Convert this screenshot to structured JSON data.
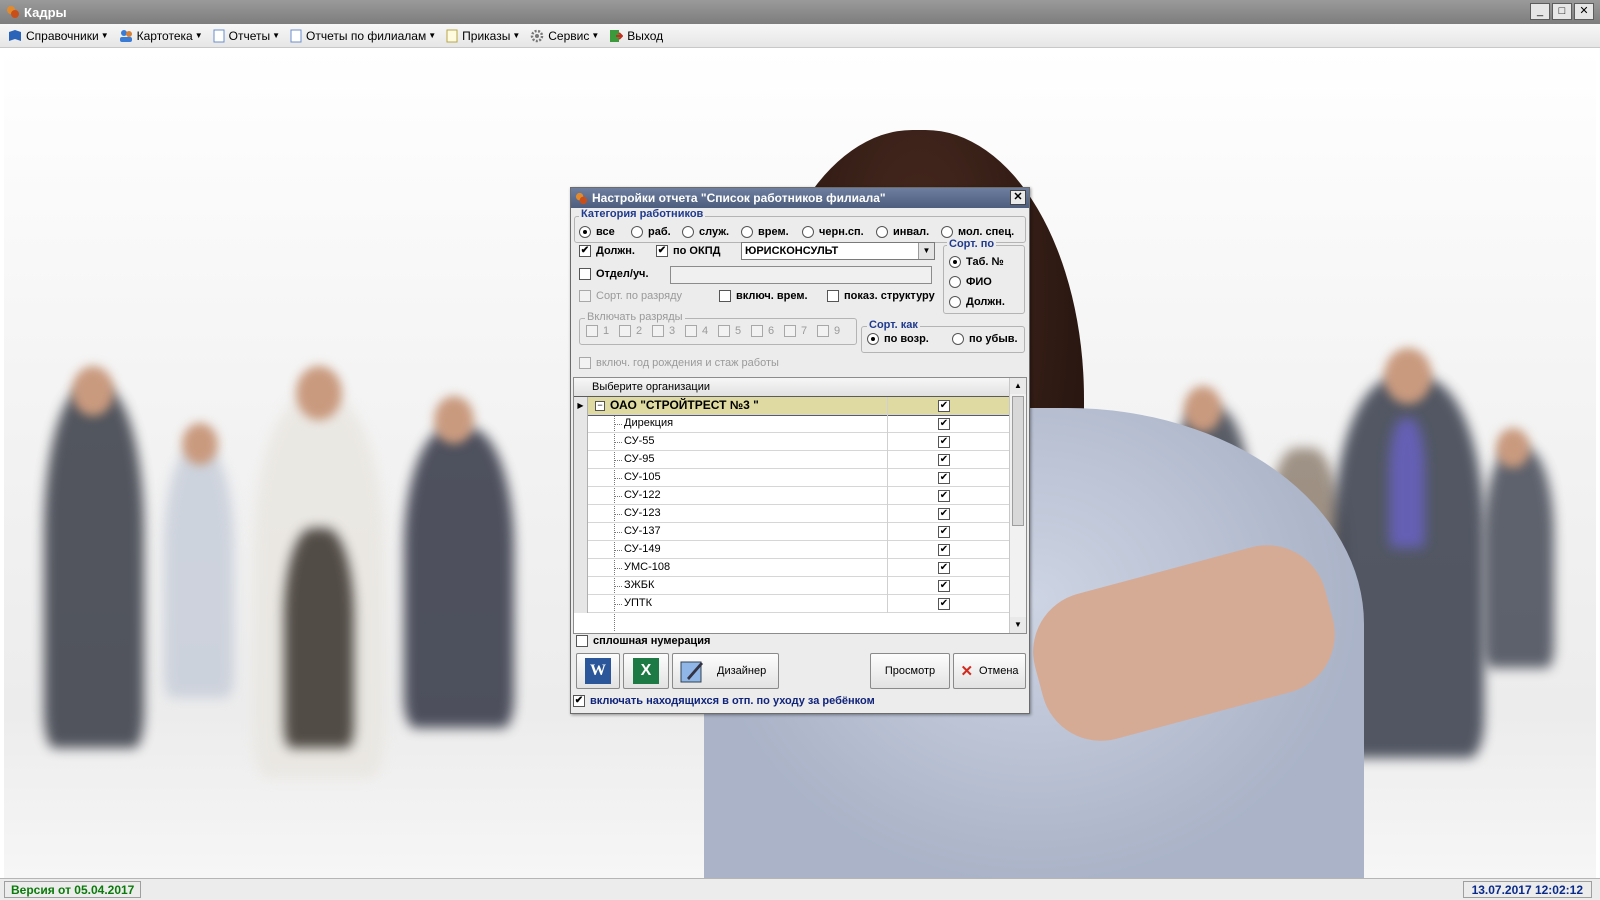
{
  "window": {
    "title": "Кадры",
    "minimize": "_",
    "maximize": "□",
    "close": "✕"
  },
  "menu": [
    {
      "label": "Справочники",
      "icon": "book-icon",
      "dropdown": true
    },
    {
      "label": "Картотека",
      "icon": "people-icon",
      "dropdown": true
    },
    {
      "label": "Отчеты",
      "icon": "document-icon",
      "dropdown": true
    },
    {
      "label": "Отчеты по филиалам",
      "icon": "document-icon",
      "dropdown": true
    },
    {
      "label": "Приказы",
      "icon": "document-icon",
      "dropdown": true
    },
    {
      "label": "Сервис",
      "icon": "gear-icon",
      "dropdown": true
    },
    {
      "label": "Выход",
      "icon": "exit-icon",
      "dropdown": false
    }
  ],
  "status": {
    "version": "Версия от 05.04.2017",
    "datetime": "13.07.2017 12:02:12"
  },
  "dialog": {
    "title": "Настройки отчета  \"Список работников филиала\"",
    "category": {
      "label": "Категория работников",
      "options": [
        "все",
        "раб.",
        "служ.",
        "врем.",
        "черн.сп.",
        "инвал.",
        "мол. спец."
      ],
      "selected": "все"
    },
    "position_check": {
      "label": "Должн.",
      "checked": true
    },
    "okpd_check": {
      "label": "по ОКПД",
      "checked": true
    },
    "position_value": "ЮРИСКОНСУЛЬТ",
    "dept_check": {
      "label": "Отдел/уч.",
      "checked": false
    },
    "dept_value": "",
    "sort_by": {
      "label": "Сорт. по",
      "options": [
        "Таб. №",
        "ФИО",
        "Должн."
      ],
      "selected": "Таб. №"
    },
    "sort_grade": {
      "label": "Сорт. по разряду",
      "checked": false,
      "disabled": true
    },
    "include_temp": {
      "label": "включ. врем.",
      "checked": false
    },
    "show_structure": {
      "label": "показ. структуру",
      "checked": false
    },
    "grades": {
      "label": "Включать разряды",
      "items": [
        "1",
        "2",
        "3",
        "4",
        "5",
        "6",
        "7",
        "9"
      ],
      "disabled": true
    },
    "sort_order": {
      "label": "Сорт. как",
      "options": [
        "по возр.",
        "по убыв."
      ],
      "selected": "по возр."
    },
    "birth_year": {
      "label": "включ. год рождения и стаж работы",
      "checked": false,
      "disabled": true
    },
    "grid": {
      "header": "Выберите организации",
      "root": {
        "name": "ОАО \"СТРОЙТРЕСТ №3 \"",
        "checked": true
      },
      "children": [
        {
          "name": "Дирекция",
          "checked": true
        },
        {
          "name": "СУ-55",
          "checked": true
        },
        {
          "name": "СУ-95",
          "checked": true
        },
        {
          "name": "СУ-105",
          "checked": true
        },
        {
          "name": "СУ-122",
          "checked": true
        },
        {
          "name": "СУ-123",
          "checked": true
        },
        {
          "name": "СУ-137",
          "checked": true
        },
        {
          "name": "СУ-149",
          "checked": true
        },
        {
          "name": "УМС-108",
          "checked": true
        },
        {
          "name": "ЗЖБК",
          "checked": true
        },
        {
          "name": "УПТК",
          "checked": true
        }
      ]
    },
    "continuous_numbering": {
      "label": "сплошная нумерация",
      "checked": false
    },
    "buttons": {
      "word": "W",
      "excel": "X",
      "designer": "Дизайнер",
      "preview": "Просмотр",
      "cancel": "Отмена"
    },
    "maternity": {
      "label": "включать находящихся в отп. по уходу за ребёнком",
      "checked": true
    },
    "colors": {
      "title": "#4d5d7d",
      "group_label": "#1f3a8f",
      "selected_row": "#dedaa2"
    }
  }
}
